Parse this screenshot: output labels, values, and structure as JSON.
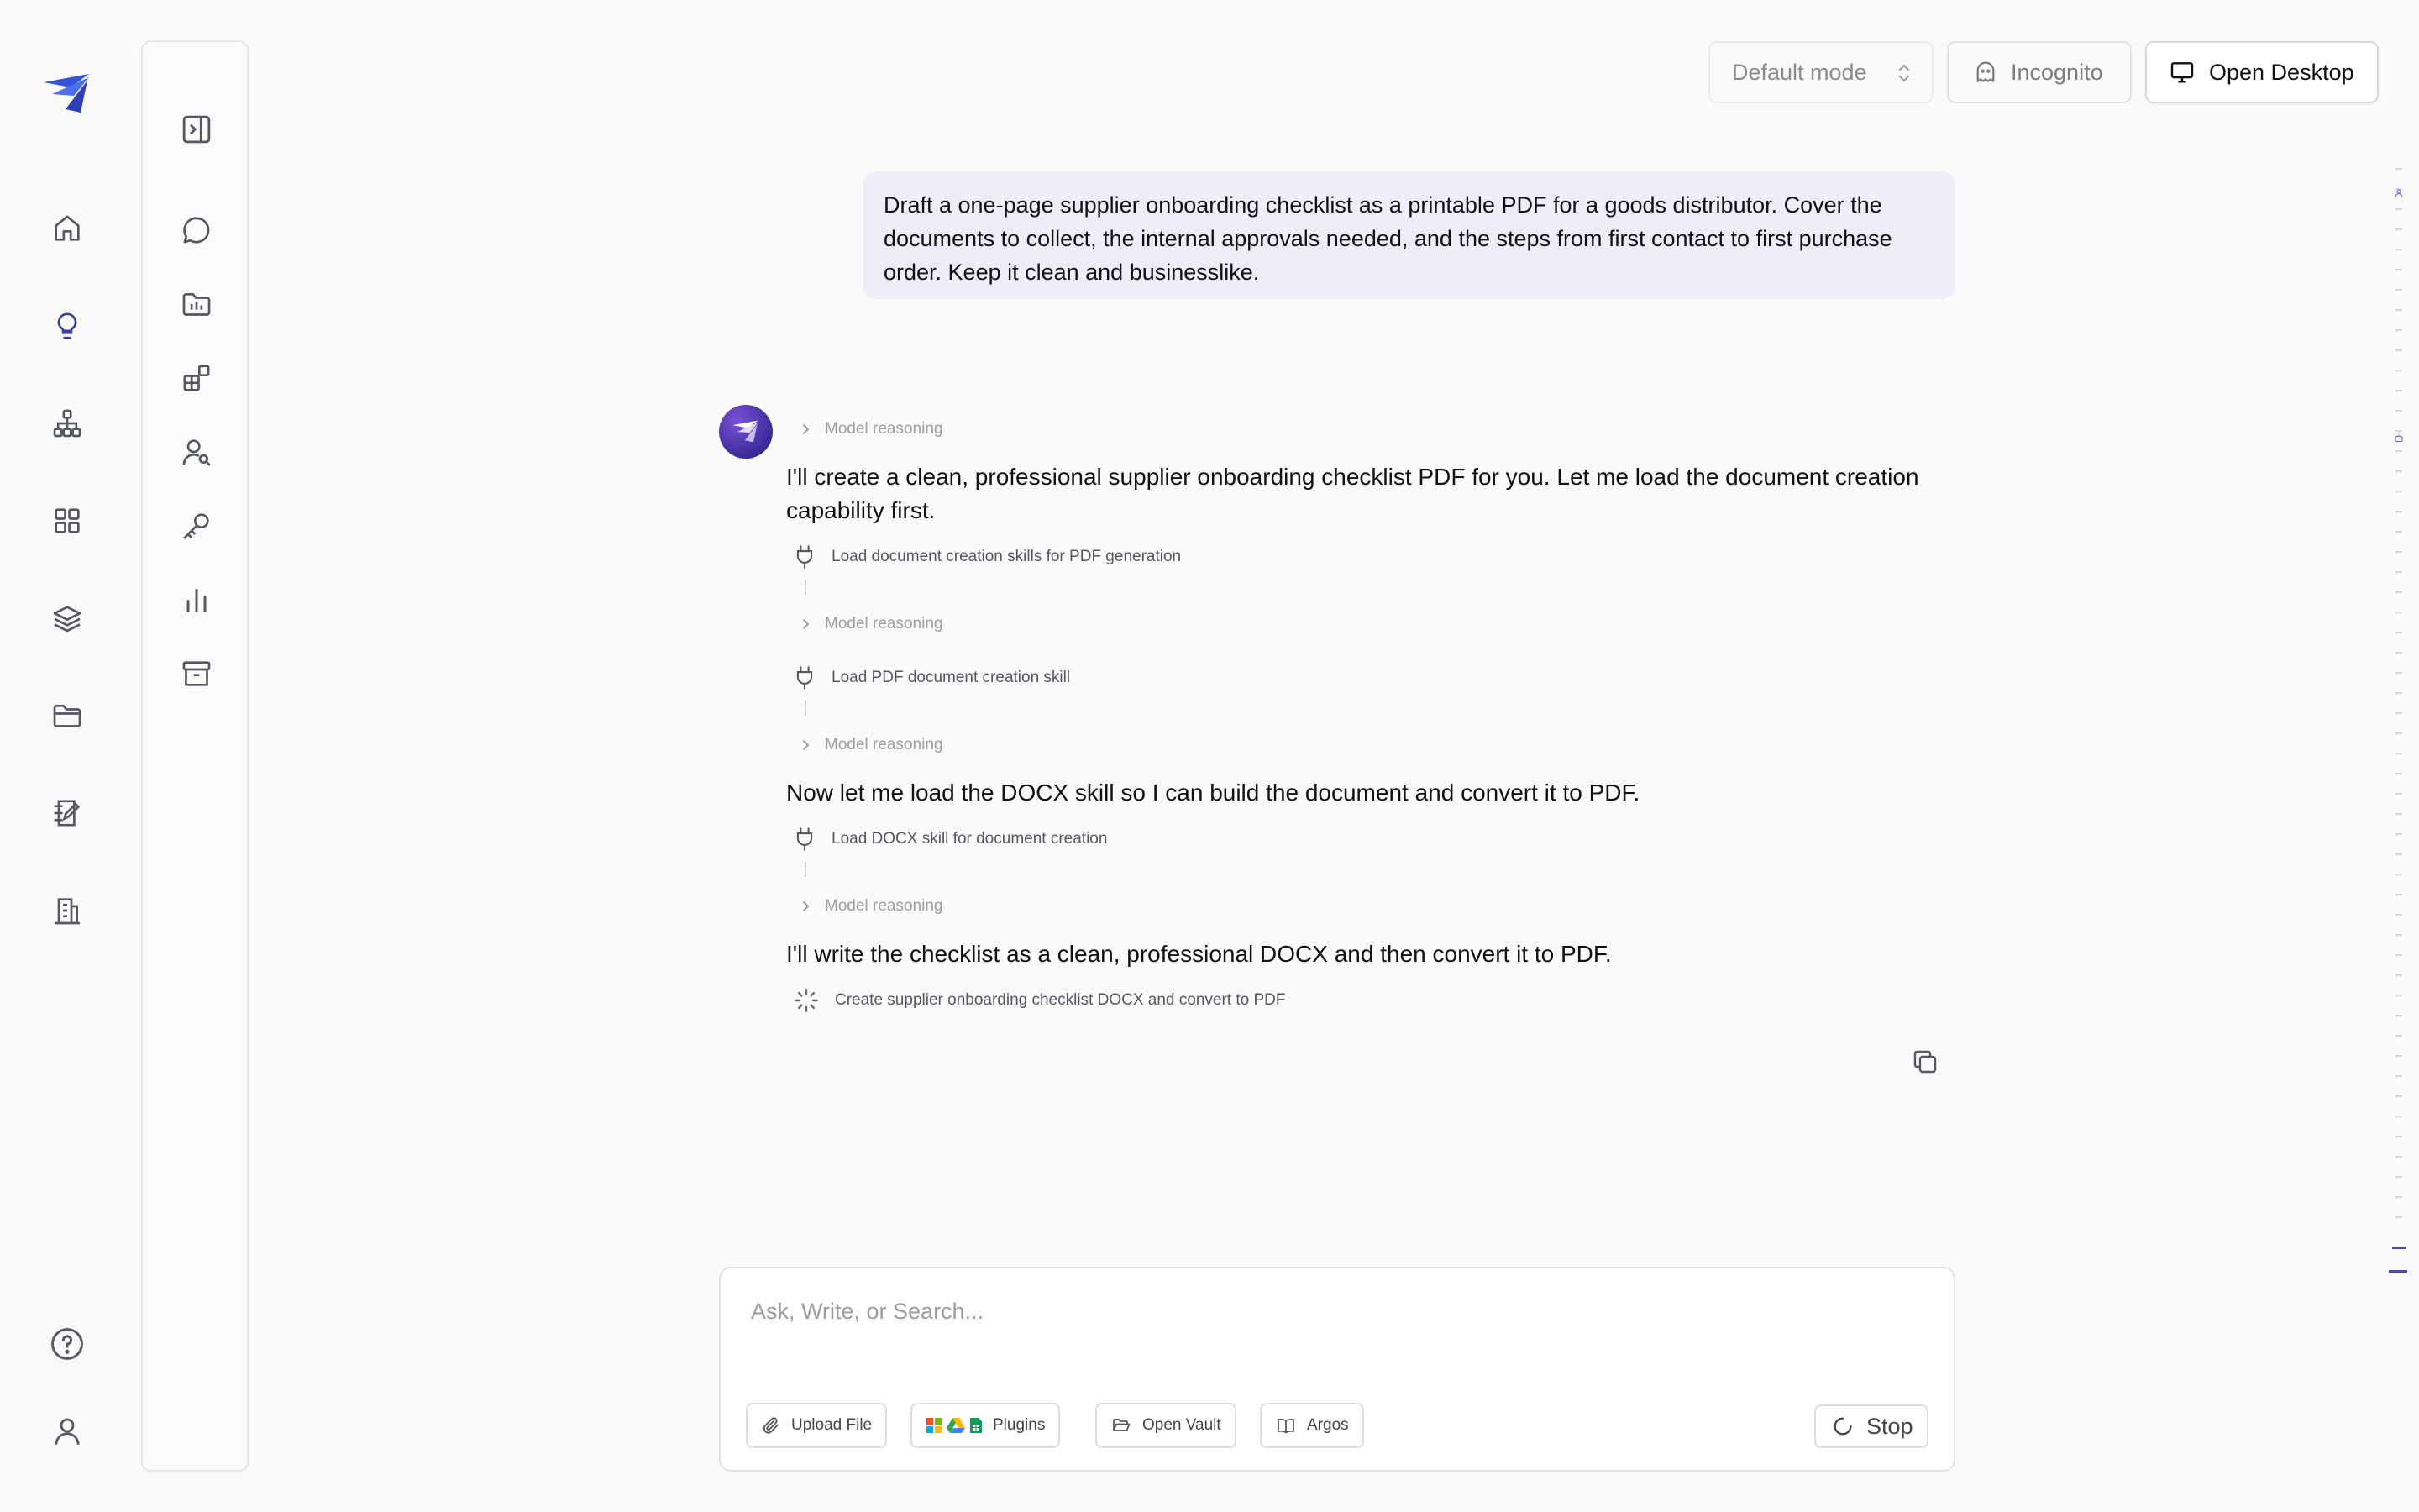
{
  "topbar": {
    "mode_label": "Default mode",
    "incognito_label": "Incognito",
    "open_desktop_label": "Open Desktop"
  },
  "rail": {
    "items": [
      {
        "icon": "home-icon"
      },
      {
        "icon": "lightbulb-icon",
        "active": true
      },
      {
        "icon": "sitemap-icon"
      },
      {
        "icon": "grid-icon"
      },
      {
        "icon": "layers-icon"
      },
      {
        "icon": "folder-icon"
      },
      {
        "icon": "notebook-icon"
      },
      {
        "icon": "building-icon"
      }
    ],
    "bottom": [
      {
        "icon": "help-icon"
      },
      {
        "icon": "user-icon"
      }
    ]
  },
  "panel": {
    "items": [
      {
        "icon": "sidebar-toggle-icon"
      },
      {
        "icon": "chat-icon"
      },
      {
        "icon": "folder-chart-icon"
      },
      {
        "icon": "widgets-icon"
      },
      {
        "icon": "user-search-icon"
      },
      {
        "icon": "key-icon"
      },
      {
        "icon": "bar-chart-icon"
      },
      {
        "icon": "archive-icon"
      }
    ]
  },
  "conversation": {
    "user_message": "Draft a one-page supplier onboarding checklist as a printable PDF for a goods distributor. Cover the documents to collect, the internal approvals needed, and the steps from first contact to first purchase order. Keep it clean and businesslike.",
    "reasoning_label": "Model reasoning",
    "assistant": {
      "msg1": "I'll create a clean, professional supplier onboarding checklist PDF for you. Let me load the document creation capability first.",
      "tool1": "Load document creation skills for PDF generation",
      "tool2": "Load PDF document creation skill",
      "msg2": "Now let me load the DOCX skill so I can build the document and convert it to PDF.",
      "tool3": "Load DOCX skill for document creation",
      "msg3": "I'll write the checklist as a clean, professional DOCX and then convert it to PDF.",
      "tool4": "Create supplier onboarding checklist DOCX and convert to PDF"
    }
  },
  "composer": {
    "placeholder": "Ask, Write, or Search...",
    "upload_label": "Upload File",
    "plugins_label": "Plugins",
    "vault_label": "Open Vault",
    "argos_label": "Argos",
    "stop_label": "Stop"
  },
  "colors": {
    "accent": "#3d4bd6",
    "user_bubble": "#efedf8",
    "active_icon": "#3b3f9a"
  }
}
